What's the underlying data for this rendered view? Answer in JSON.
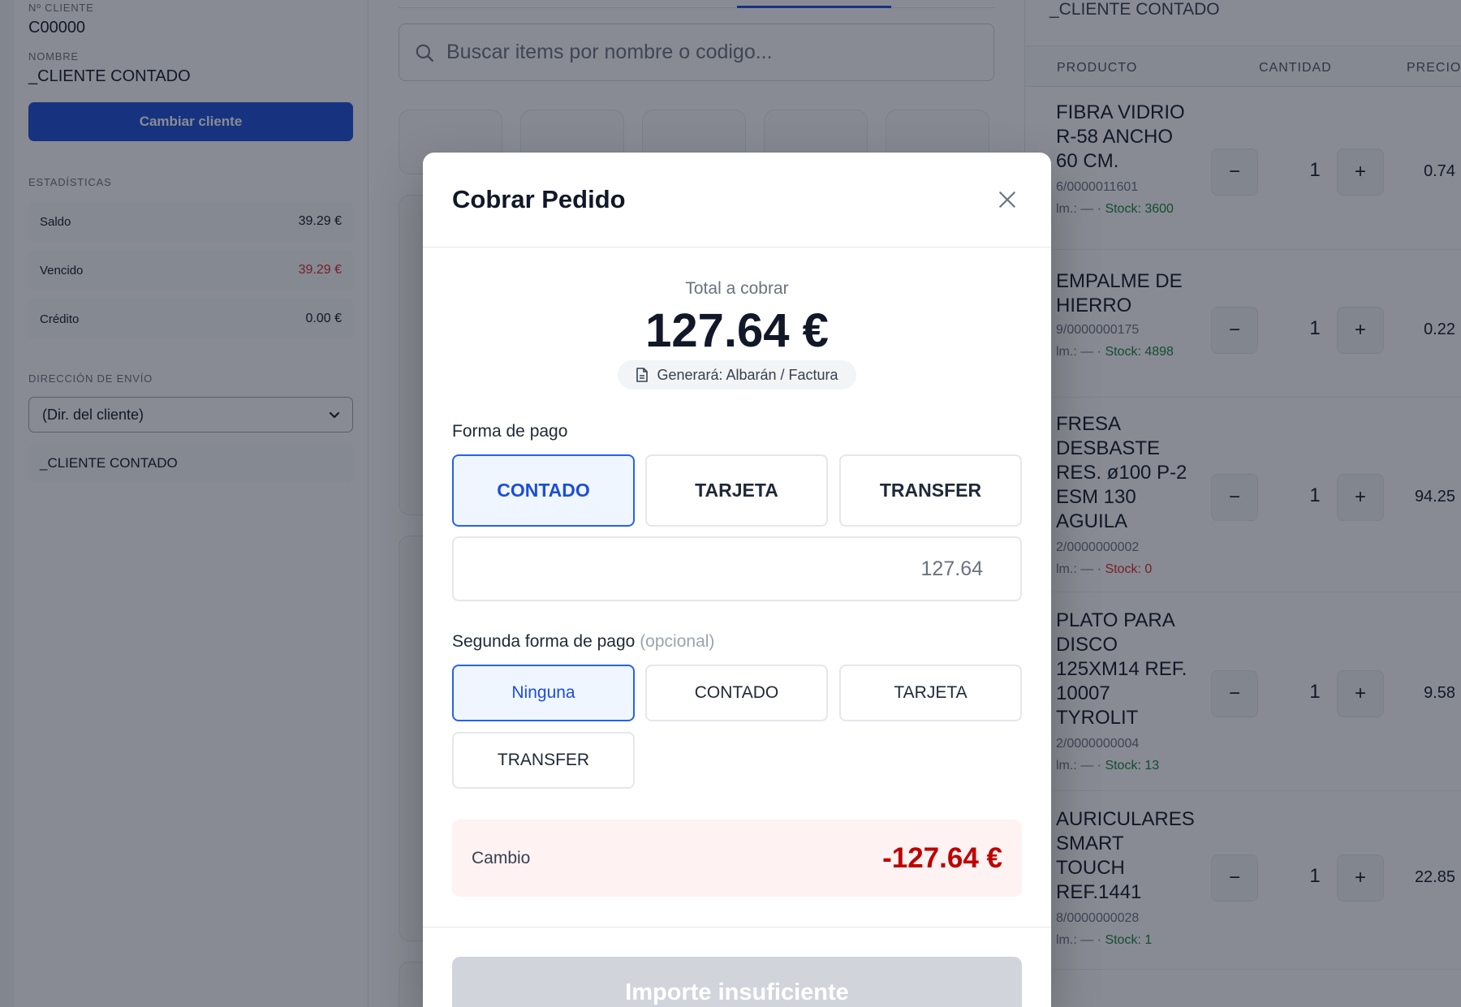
{
  "client": {
    "number_label": "Nº CLIENTE",
    "number_value": "C00000",
    "name_label": "NOMBRE",
    "name_value": "_CLIENTE CONTADO",
    "change_button": "Cambiar cliente"
  },
  "stats": {
    "title": "ESTADÍSTICAS",
    "rows": [
      {
        "label": "Saldo",
        "value": "39.29 €"
      },
      {
        "label": "Vencido",
        "value": "39.29 €"
      },
      {
        "label": "Crédito",
        "value": "0.00 €"
      }
    ],
    "overdue_color": "#dc2626"
  },
  "shipping": {
    "title": "DIRECCIÓN DE ENVÍO",
    "selected": "(Dir. del cliente)",
    "address_name": "_CLIENTE CONTADO"
  },
  "search": {
    "placeholder": "Buscar items por nombre o codigo..."
  },
  "cart": {
    "client_name": "_CLIENTE CONTADO",
    "headers": {
      "product": "PRODUCTO",
      "quantity": "CANTIDAD",
      "price": "PRECIO"
    },
    "items": [
      {
        "name": "FIBRA VIDRIO R-58 ANCHO 60 CM.",
        "code": "6/0000011601",
        "stock_prefix": "lm.: — · ",
        "stock": "Stock: 3600",
        "stock_ok": true,
        "qty": "1",
        "price": "0.74"
      },
      {
        "name": "EMPALME DE HIERRO",
        "code": "9/0000000175",
        "stock_prefix": "lm.: — · ",
        "stock": "Stock: 4898",
        "stock_ok": true,
        "qty": "1",
        "price": "0.22"
      },
      {
        "name": "FRESA DESBASTE RES. ø100 P-2 ESM 130 AGUILA",
        "code": "2/0000000002",
        "stock_prefix": "lm.: — · ",
        "stock": "Stock: 0",
        "stock_ok": false,
        "qty": "1",
        "price": "94.25"
      },
      {
        "name": "PLATO PARA DISCO 125XM14 REF. 10007 TYROLIT",
        "code": "2/0000000004",
        "stock_prefix": "lm.: — · ",
        "stock": "Stock: 13",
        "stock_ok": true,
        "qty": "1",
        "price": "9.58"
      },
      {
        "name": "AURICULARES SMART TOUCH REF.1441",
        "code": "8/0000000028",
        "stock_prefix": "lm.: — · ",
        "stock": "Stock: 1",
        "stock_ok": true,
        "qty": "1",
        "price": "22.85"
      }
    ],
    "minus": "−",
    "plus": "+"
  },
  "modal": {
    "title": "Cobrar Pedido",
    "total_label": "Total a cobrar",
    "total_amount": "127.64 €",
    "doc_badge": "Generará: Albarán / Factura",
    "payment_label": "Forma de pago",
    "payment_methods": [
      "CONTADO",
      "TARJETA",
      "TRANSFER"
    ],
    "payment_selected": "CONTADO",
    "amount_placeholder": "127.64",
    "second_payment_label": "Segunda forma de pago",
    "second_payment_optional": "(opcional)",
    "second_payment_methods": [
      "Ninguna",
      "CONTADO",
      "TARJETA",
      "TRANSFER"
    ],
    "second_payment_selected": "Ninguna",
    "change_label": "Cambio",
    "change_value": "-127.64 €",
    "submit_label": "Importe insuficiente",
    "accent_color": "#2563eb",
    "negative_color": "#c00000"
  }
}
